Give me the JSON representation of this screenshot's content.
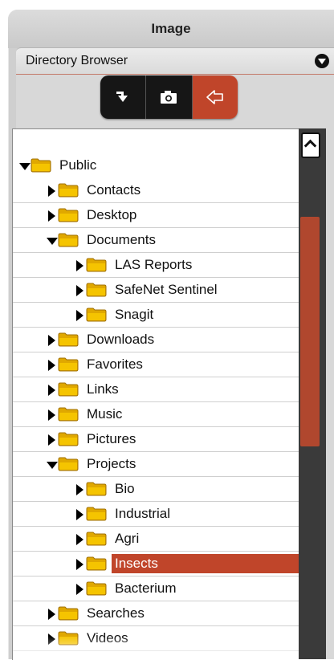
{
  "panel": {
    "title": "Image"
  },
  "section": {
    "label": "Directory Browser"
  },
  "toolbar": {
    "buttons": [
      {
        "name": "import-button",
        "icon": "import-arrow-icon"
      },
      {
        "name": "camera-button",
        "icon": "camera-icon"
      },
      {
        "name": "back-button",
        "icon": "back-arrow-icon",
        "active": true
      }
    ]
  },
  "colors": {
    "accent": "#c0452a",
    "folder": "#f5c400",
    "scrollbar": "#3a3a3a"
  },
  "tree": [
    {
      "label": "Public",
      "level": 0,
      "expanded": true
    },
    {
      "label": "Contacts",
      "level": 1,
      "expanded": false
    },
    {
      "label": "Desktop",
      "level": 1,
      "expanded": false
    },
    {
      "label": "Documents",
      "level": 1,
      "expanded": true
    },
    {
      "label": "LAS Reports",
      "level": 2,
      "expanded": false
    },
    {
      "label": "SafeNet Sentinel",
      "level": 2,
      "expanded": false
    },
    {
      "label": "Snagit",
      "level": 2,
      "expanded": false
    },
    {
      "label": "Downloads",
      "level": 1,
      "expanded": false
    },
    {
      "label": "Favorites",
      "level": 1,
      "expanded": false
    },
    {
      "label": "Links",
      "level": 1,
      "expanded": false
    },
    {
      "label": "Music",
      "level": 1,
      "expanded": false
    },
    {
      "label": "Pictures",
      "level": 1,
      "expanded": false
    },
    {
      "label": "Projects",
      "level": 1,
      "expanded": true
    },
    {
      "label": "Bio",
      "level": 2,
      "expanded": false
    },
    {
      "label": "Industrial",
      "level": 2,
      "expanded": false
    },
    {
      "label": "Agri",
      "level": 2,
      "expanded": false
    },
    {
      "label": "Insects",
      "level": 2,
      "expanded": false,
      "selected": true
    },
    {
      "label": "Bacterium",
      "level": 2,
      "expanded": false
    },
    {
      "label": "Searches",
      "level": 1,
      "expanded": false
    },
    {
      "label": "Videos",
      "level": 1,
      "expanded": false
    }
  ]
}
